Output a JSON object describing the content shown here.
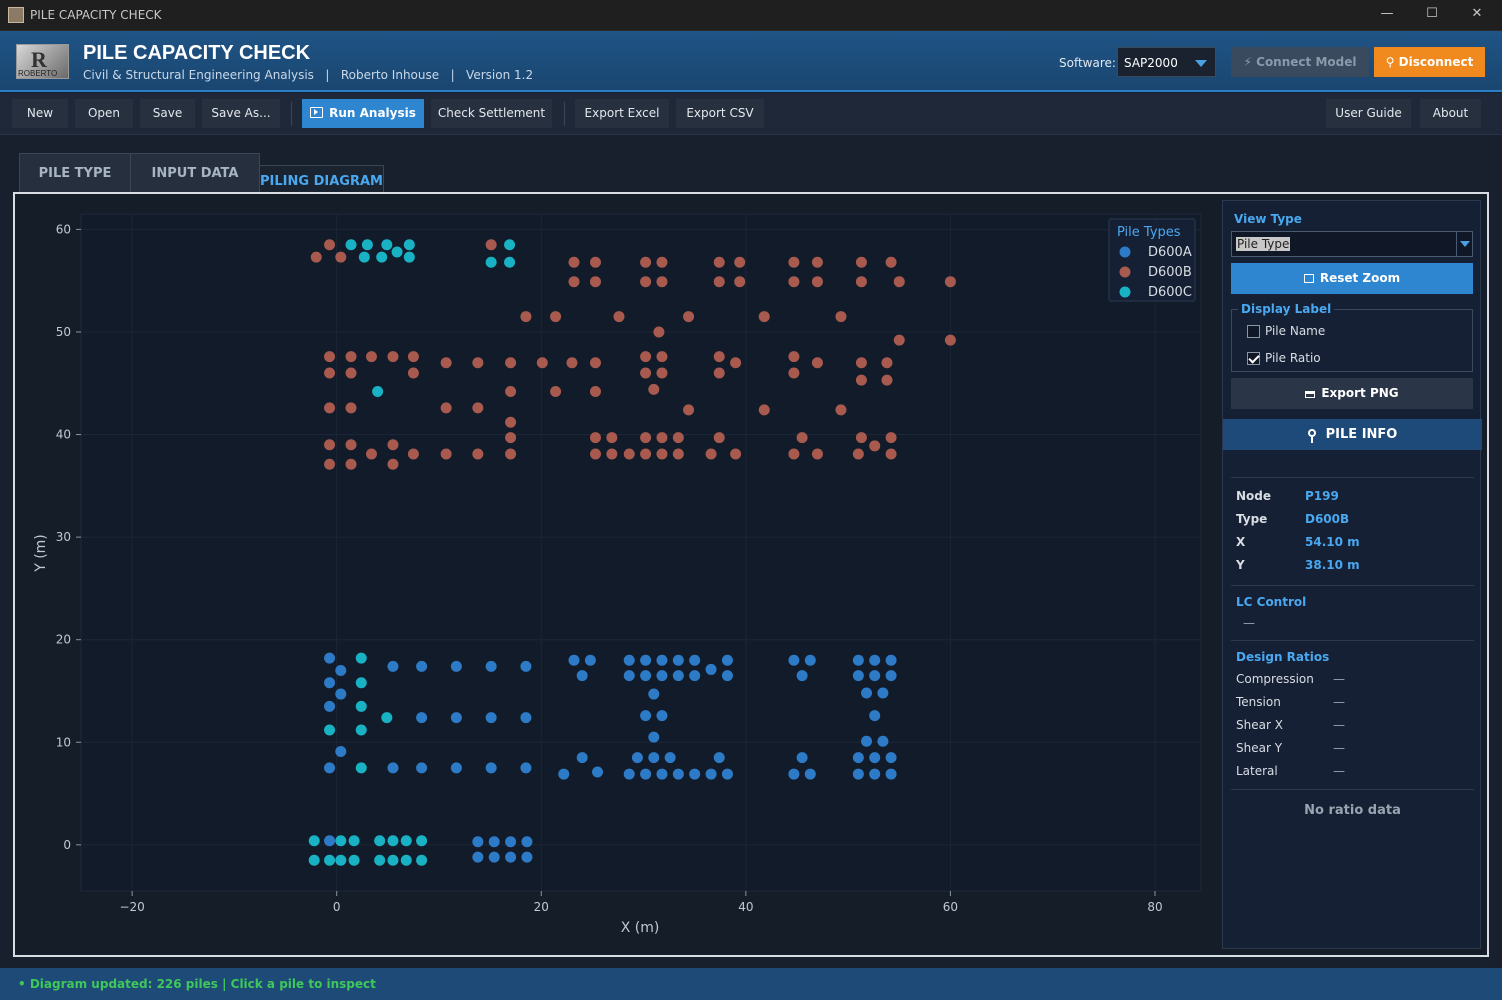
{
  "window": {
    "title": "PILE CAPACITY CHECK",
    "minimize": "—",
    "maximize": "☐",
    "close": "✕"
  },
  "header": {
    "title": "PILE CAPACITY CHECK",
    "subtitle": "Civil & Structural Engineering Analysis   |   Roberto Inhouse   |   Version 1.2",
    "logo_text": "ROBERTO",
    "software_label": "Software:",
    "software_value": "SAP2000",
    "connect_label": "⚡ Connect Model",
    "disconnect_label": "⚲ Disconnect"
  },
  "toolbar": {
    "new": "New",
    "open": "Open",
    "save": "Save",
    "save_as": "Save As...",
    "run": "Run Analysis",
    "check": "Check Settlement",
    "export_excel": "Export Excel",
    "export_csv": "Export CSV",
    "guide": "User Guide",
    "about": "About"
  },
  "tabs": [
    "PILE TYPE",
    "INPUT DATA",
    "PILING DIAGRAM"
  ],
  "side": {
    "view_type_label": "View Type",
    "view_type_value": "Pile Type",
    "reset_zoom": "Reset Zoom",
    "display_label": "Display Label",
    "pile_name": "Pile Name",
    "pile_ratio": "Pile Ratio",
    "export_png": "Export PNG",
    "pile_info": "PILE INFO",
    "node_label": "Node",
    "node_value": "P199",
    "type_label": "Type",
    "type_value": "D600B",
    "x_label": "X",
    "x_value": "54.10 m",
    "y_label": "Y",
    "y_value": "38.10 m",
    "lc_control": "LC Control",
    "lc_value": "—",
    "design_ratios": "Design Ratios",
    "ratios": [
      {
        "name": "Compression",
        "value": "—"
      },
      {
        "name": "Tension",
        "value": "—"
      },
      {
        "name": "Shear X",
        "value": "—"
      },
      {
        "name": "Shear Y",
        "value": "—"
      },
      {
        "name": "Lateral",
        "value": "—"
      }
    ],
    "no_ratio": "No ratio data"
  },
  "status": "• Diagram updated: 226 piles | Click a pile to inspect",
  "colors": {
    "D600A": "#2d7bc6",
    "D600B": "#a85a4e",
    "D600C": "#19b2c4",
    "accent": "#2f86d0"
  },
  "chart_data": {
    "type": "scatter",
    "xlabel": "X (m)",
    "ylabel": "Y (m)",
    "xlim": [
      -25,
      84.5
    ],
    "ylim": [
      -4.5,
      61.5
    ],
    "xticks": [
      -20,
      0,
      20,
      40,
      60,
      80
    ],
    "xtick_labels": [
      "−20",
      "0",
      "20",
      "40",
      "60",
      "80"
    ],
    "yticks": [
      0,
      10,
      20,
      30,
      40,
      50,
      60
    ],
    "legend_title": "Pile Types",
    "legend_position": "top-right",
    "series": [
      {
        "name": "D600A",
        "color": "#2d7bc6",
        "points": [
          [
            -0.7,
            18.2
          ],
          [
            0.4,
            17.0
          ],
          [
            -0.7,
            15.8
          ],
          [
            0.4,
            14.7
          ],
          [
            -0.7,
            13.5
          ],
          [
            0.4,
            9.1
          ],
          [
            -0.7,
            7.5
          ],
          [
            5.5,
            17.4
          ],
          [
            8.3,
            17.4
          ],
          [
            11.7,
            17.4
          ],
          [
            15.1,
            17.4
          ],
          [
            18.5,
            17.4
          ],
          [
            8.3,
            12.4
          ],
          [
            11.7,
            12.4
          ],
          [
            15.1,
            12.4
          ],
          [
            18.5,
            12.4
          ],
          [
            5.5,
            7.5
          ],
          [
            8.3,
            7.5
          ],
          [
            11.7,
            7.5
          ],
          [
            15.1,
            7.5
          ],
          [
            18.5,
            7.5
          ],
          [
            23.2,
            18.0
          ],
          [
            24.8,
            18.0
          ],
          [
            24.0,
            16.5
          ],
          [
            22.2,
            6.9
          ],
          [
            24.0,
            8.5
          ],
          [
            25.5,
            7.1
          ],
          [
            28.6,
            18.0
          ],
          [
            30.2,
            18.0
          ],
          [
            31.8,
            18.0
          ],
          [
            33.4,
            18.0
          ],
          [
            35.0,
            18.0
          ],
          [
            28.6,
            16.5
          ],
          [
            30.2,
            16.5
          ],
          [
            31.8,
            16.5
          ],
          [
            33.4,
            16.5
          ],
          [
            35.0,
            16.5
          ],
          [
            31.0,
            14.7
          ],
          [
            30.2,
            12.6
          ],
          [
            31.8,
            12.6
          ],
          [
            31.0,
            10.5
          ],
          [
            29.4,
            8.5
          ],
          [
            31.0,
            8.5
          ],
          [
            32.6,
            8.5
          ],
          [
            28.6,
            6.9
          ],
          [
            30.2,
            6.9
          ],
          [
            31.8,
            6.9
          ],
          [
            33.4,
            6.9
          ],
          [
            35.0,
            6.9
          ],
          [
            38.2,
            18.0
          ],
          [
            36.6,
            17.1
          ],
          [
            38.2,
            16.5
          ],
          [
            37.4,
            8.5
          ],
          [
            36.6,
            6.9
          ],
          [
            38.2,
            6.9
          ],
          [
            44.7,
            18.0
          ],
          [
            46.3,
            18.0
          ],
          [
            45.5,
            16.5
          ],
          [
            45.5,
            8.5
          ],
          [
            44.7,
            6.9
          ],
          [
            46.3,
            6.9
          ],
          [
            51.0,
            18.0
          ],
          [
            52.6,
            18.0
          ],
          [
            54.2,
            18.0
          ],
          [
            51.0,
            16.5
          ],
          [
            52.6,
            16.5
          ],
          [
            54.2,
            16.5
          ],
          [
            51.8,
            14.8
          ],
          [
            53.4,
            14.8
          ],
          [
            52.6,
            12.6
          ],
          [
            51.8,
            10.1
          ],
          [
            53.4,
            10.1
          ],
          [
            51.0,
            8.5
          ],
          [
            52.6,
            8.5
          ],
          [
            54.2,
            8.5
          ],
          [
            51.0,
            6.9
          ],
          [
            52.6,
            6.9
          ],
          [
            54.2,
            6.9
          ],
          [
            -0.7,
            0.4
          ],
          [
            13.8,
            0.3
          ],
          [
            15.4,
            0.3
          ],
          [
            17.0,
            0.3
          ],
          [
            18.6,
            0.3
          ],
          [
            13.8,
            -1.2
          ],
          [
            15.4,
            -1.2
          ],
          [
            17.0,
            -1.2
          ],
          [
            18.6,
            -1.2
          ]
        ]
      },
      {
        "name": "D600B",
        "color": "#a85a4e",
        "points": [
          [
            -2.0,
            57.3
          ],
          [
            -0.7,
            58.5
          ],
          [
            0.4,
            57.3
          ],
          [
            15.1,
            58.5
          ],
          [
            23.2,
            56.8
          ],
          [
            25.3,
            56.8
          ],
          [
            23.2,
            54.9
          ],
          [
            25.3,
            54.9
          ],
          [
            30.2,
            56.8
          ],
          [
            31.8,
            56.8
          ],
          [
            30.2,
            54.9
          ],
          [
            31.8,
            54.9
          ],
          [
            37.4,
            56.8
          ],
          [
            39.4,
            56.8
          ],
          [
            37.4,
            54.9
          ],
          [
            39.4,
            54.9
          ],
          [
            44.7,
            56.8
          ],
          [
            47.0,
            56.8
          ],
          [
            44.7,
            54.9
          ],
          [
            47.0,
            54.9
          ],
          [
            51.3,
            56.8
          ],
          [
            54.2,
            56.8
          ],
          [
            51.3,
            54.9
          ],
          [
            55.0,
            54.9
          ],
          [
            60.0,
            54.9
          ],
          [
            18.5,
            51.5
          ],
          [
            21.4,
            51.5
          ],
          [
            27.6,
            51.5
          ],
          [
            34.4,
            51.5
          ],
          [
            41.8,
            51.5
          ],
          [
            49.3,
            51.5
          ],
          [
            31.5,
            50.0
          ],
          [
            55.0,
            49.2
          ],
          [
            60.0,
            49.2
          ],
          [
            -0.7,
            47.6
          ],
          [
            1.4,
            47.6
          ],
          [
            3.4,
            47.6
          ],
          [
            5.5,
            47.6
          ],
          [
            7.5,
            47.6
          ],
          [
            -0.7,
            46.0
          ],
          [
            1.4,
            46.0
          ],
          [
            7.5,
            46.0
          ],
          [
            10.7,
            47.0
          ],
          [
            13.8,
            47.0
          ],
          [
            17.0,
            47.0
          ],
          [
            20.1,
            47.0
          ],
          [
            23.0,
            47.0
          ],
          [
            25.3,
            47.0
          ],
          [
            30.2,
            47.6
          ],
          [
            31.8,
            47.6
          ],
          [
            30.2,
            46.0
          ],
          [
            31.8,
            46.0
          ],
          [
            31.0,
            44.4
          ],
          [
            37.4,
            47.6
          ],
          [
            39.0,
            47.0
          ],
          [
            37.4,
            46.0
          ],
          [
            44.7,
            47.6
          ],
          [
            47.0,
            47.0
          ],
          [
            44.7,
            46.0
          ],
          [
            51.3,
            47.0
          ],
          [
            53.8,
            47.0
          ],
          [
            51.3,
            45.3
          ],
          [
            53.8,
            45.3
          ],
          [
            17.0,
            44.2
          ],
          [
            21.4,
            44.2
          ],
          [
            25.3,
            44.2
          ],
          [
            -0.7,
            42.6
          ],
          [
            1.4,
            42.6
          ],
          [
            10.7,
            42.6
          ],
          [
            13.8,
            42.6
          ],
          [
            17.0,
            41.2
          ],
          [
            34.4,
            42.4
          ],
          [
            41.8,
            42.4
          ],
          [
            49.3,
            42.4
          ],
          [
            17.0,
            39.7
          ],
          [
            25.3,
            39.7
          ],
          [
            26.9,
            39.7
          ],
          [
            30.2,
            39.7
          ],
          [
            31.8,
            39.7
          ],
          [
            33.4,
            39.7
          ],
          [
            37.4,
            39.7
          ],
          [
            45.5,
            39.7
          ],
          [
            51.3,
            39.7
          ],
          [
            54.2,
            39.7
          ],
          [
            -0.7,
            39.0
          ],
          [
            1.4,
            39.0
          ],
          [
            5.5,
            39.0
          ],
          [
            52.6,
            38.9
          ],
          [
            -0.7,
            37.1
          ],
          [
            1.4,
            37.1
          ],
          [
            5.5,
            37.1
          ],
          [
            3.4,
            38.1
          ],
          [
            7.5,
            38.1
          ],
          [
            10.7,
            38.1
          ],
          [
            13.8,
            38.1
          ],
          [
            17.0,
            38.1
          ],
          [
            25.3,
            38.1
          ],
          [
            26.9,
            38.1
          ],
          [
            28.6,
            38.1
          ],
          [
            30.2,
            38.1
          ],
          [
            31.8,
            38.1
          ],
          [
            33.4,
            38.1
          ],
          [
            36.6,
            38.1
          ],
          [
            39.0,
            38.1
          ],
          [
            44.7,
            38.1
          ],
          [
            47.0,
            38.1
          ],
          [
            51.0,
            38.1
          ],
          [
            54.2,
            38.1
          ]
        ]
      },
      {
        "name": "D600C",
        "color": "#19b2c4",
        "points": [
          [
            1.4,
            58.5
          ],
          [
            3.0,
            58.5
          ],
          [
            4.9,
            58.5
          ],
          [
            7.1,
            58.5
          ],
          [
            2.7,
            57.3
          ],
          [
            4.4,
            57.3
          ],
          [
            5.9,
            57.8
          ],
          [
            7.1,
            57.3
          ],
          [
            16.9,
            58.5
          ],
          [
            15.1,
            56.8
          ],
          [
            16.9,
            56.8
          ],
          [
            4.0,
            44.2
          ],
          [
            2.4,
            18.2
          ],
          [
            2.4,
            15.8
          ],
          [
            2.4,
            13.5
          ],
          [
            2.4,
            11.2
          ],
          [
            -0.7,
            11.2
          ],
          [
            4.9,
            12.4
          ],
          [
            2.4,
            7.5
          ],
          [
            -2.2,
            0.4
          ],
          [
            0.4,
            0.4
          ],
          [
            1.7,
            0.4
          ],
          [
            4.2,
            0.4
          ],
          [
            5.5,
            0.4
          ],
          [
            6.8,
            0.4
          ],
          [
            8.3,
            0.4
          ],
          [
            -2.2,
            -1.5
          ],
          [
            -0.7,
            -1.5
          ],
          [
            0.4,
            -1.5
          ],
          [
            1.7,
            -1.5
          ],
          [
            4.2,
            -1.5
          ],
          [
            5.5,
            -1.5
          ],
          [
            6.8,
            -1.5
          ],
          [
            8.3,
            -1.5
          ]
        ]
      }
    ]
  }
}
